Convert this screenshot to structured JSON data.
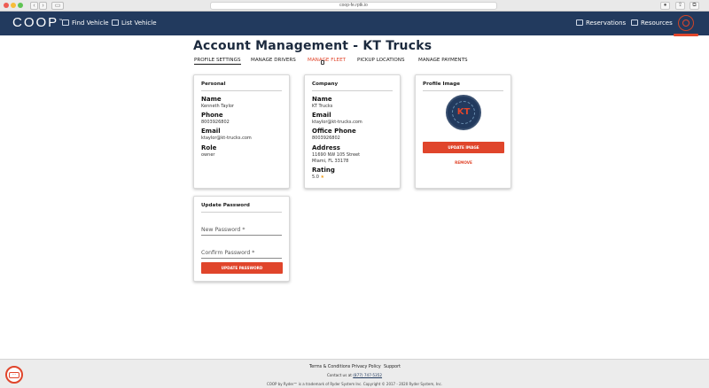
{
  "browser": {
    "url": "coop-fe.rptk.io",
    "nav_back": "‹",
    "nav_forward": "›",
    "sidebar_toggle": "▭"
  },
  "header": {
    "logo": "COOP",
    "logo_tm": "™",
    "nav_left": [
      {
        "label": "Find Vehicle",
        "icon": "find-vehicle-icon"
      },
      {
        "label": "List Vehicle",
        "icon": "list-vehicle-icon"
      }
    ],
    "nav_right": [
      {
        "label": "Reservations",
        "icon": "reservations-icon"
      },
      {
        "label": "Resources",
        "icon": "resources-icon"
      }
    ]
  },
  "page": {
    "title": "Account Management - KT Trucks",
    "tabs": [
      {
        "label": "PROFILE SETTINGS",
        "state": "active"
      },
      {
        "label": "MANAGE DRIVERS",
        "state": ""
      },
      {
        "label": "MANAGE FLEET",
        "state": "hover"
      },
      {
        "label": "PICKUP LOCATIONS",
        "state": ""
      },
      {
        "label": "MANAGE PAYMENTS",
        "state": ""
      }
    ]
  },
  "personal": {
    "heading": "Personal",
    "name_label": "Name",
    "name": "Kenneth Taylor",
    "phone_label": "Phone",
    "phone": "8003926802",
    "email_label": "Email",
    "email": "ktaylor@kt-trucks.com",
    "role_label": "Role",
    "role": "owner"
  },
  "company": {
    "heading": "Company",
    "name_label": "Name",
    "name": "KT Trucks",
    "email_label": "Email",
    "email": "ktaylor@kt-trucks.com",
    "office_phone_label": "Office Phone",
    "office_phone": "8003926802",
    "address_label": "Address",
    "address_line1": "11690 NW 105 Street",
    "address_line2": "Miami, FL 33178",
    "rating_label": "Rating",
    "rating": "5.0",
    "rating_star": "★"
  },
  "profile_image": {
    "heading": "Profile Image",
    "badge_text": "KT",
    "update_label": "UPDATE IMAGE",
    "remove_label": "REMOVE"
  },
  "password": {
    "heading": "Update Password",
    "new_placeholder": "New Password *",
    "confirm_placeholder": "Confirm Password *",
    "button_label": "UPDATE PASSWORD"
  },
  "footer": {
    "links": [
      "Terms & Conditions",
      "Privacy Policy",
      "Support"
    ],
    "contact_prefix": "Contact us at ",
    "contact_phone": "(877) 747-5352",
    "copyright": "COOP by Ryder™ is a trademark of Ryder System Inc. Copyright © 2017 - 2020 Ryder System, Inc."
  },
  "colors": {
    "brand_navy": "#223a5e",
    "accent_red": "#e0452b"
  }
}
